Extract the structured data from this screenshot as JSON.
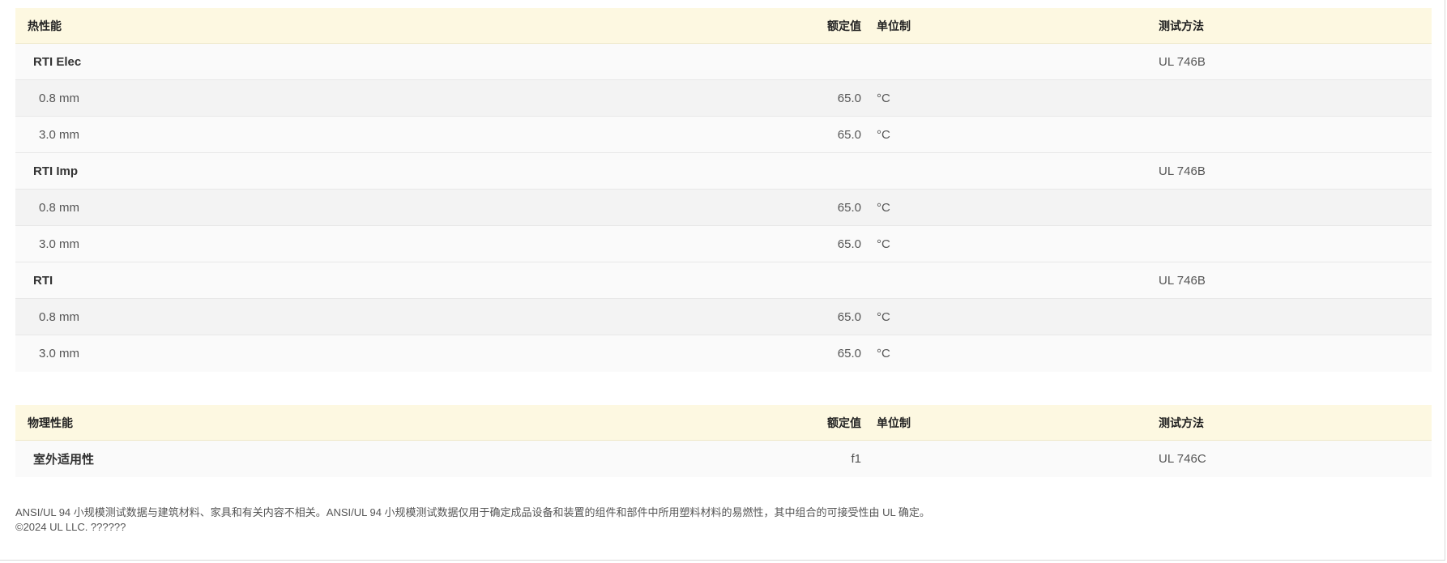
{
  "thermal": {
    "header": {
      "property": "热性能",
      "rated_value": "额定值",
      "unit": "单位制",
      "test_method": "测试方法"
    },
    "rows": [
      {
        "name": "RTI Elec",
        "value": "",
        "unit": "",
        "method": "UL 746B"
      },
      {
        "name": "0.8 mm",
        "value": "65.0",
        "unit": "°C",
        "method": ""
      },
      {
        "name": "3.0 mm",
        "value": "65.0",
        "unit": "°C",
        "method": ""
      },
      {
        "name": "RTI Imp",
        "value": "",
        "unit": "",
        "method": "UL 746B"
      },
      {
        "name": "0.8 mm",
        "value": "65.0",
        "unit": "°C",
        "method": ""
      },
      {
        "name": "3.0 mm",
        "value": "65.0",
        "unit": "°C",
        "method": ""
      },
      {
        "name": "RTI",
        "value": "",
        "unit": "",
        "method": "UL 746B"
      },
      {
        "name": "0.8 mm",
        "value": "65.0",
        "unit": "°C",
        "method": ""
      },
      {
        "name": "3.0 mm",
        "value": "65.0",
        "unit": "°C",
        "method": ""
      }
    ]
  },
  "physical": {
    "header": {
      "property": "物理性能",
      "rated_value": "额定值",
      "unit": "单位制",
      "test_method": "测试方法"
    },
    "rows": [
      {
        "name": "室外适用性",
        "value": "f1",
        "unit": "",
        "method": "UL 746C"
      }
    ]
  },
  "footer": {
    "disclaimer": "ANSI/UL 94 小规模测试数据与建筑材料、家具和有关内容不相关。ANSI/UL 94 小规模测试数据仅用于确定成品设备和装置的组件和部件中所用塑料材料的易燃性，其中组合的可接受性由 UL 确定。",
    "copyright": "©2024 UL LLC. ??????"
  }
}
